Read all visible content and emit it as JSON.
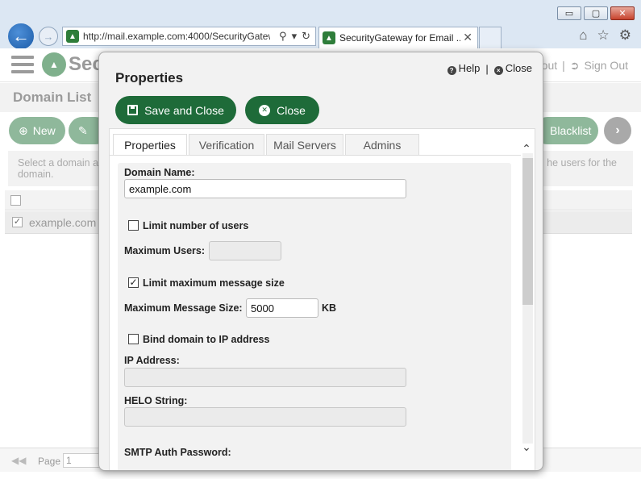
{
  "browser": {
    "url": "http://mail.example.com:4000/SecurityGatew",
    "tab_title": "SecurityGateway for Email ...",
    "tab_close": "✕",
    "window_controls": {
      "minimize": "▭",
      "maximize": "▢",
      "close": "✕"
    },
    "icons": [
      "back-arrow-icon",
      "forward-arrow-icon",
      "search-icon",
      "dropdown-icon",
      "refresh-icon",
      "home-icon",
      "favorites-star-icon",
      "settings-gear-icon"
    ]
  },
  "app": {
    "logo_text": "Sec",
    "user_menu": {
      "logout_partial": "out",
      "separator": "|",
      "sign_out": "Sign Out"
    },
    "section_title": "Domain List",
    "toolbar": {
      "new_label": "New",
      "blacklist_label": "Blacklist"
    },
    "info": {
      "left_line1": "Select a domain a",
      "left_line2": "domain.",
      "right_text": "he users for the"
    },
    "grid": {
      "rows": [
        {
          "checked": true,
          "domain": "example.com"
        }
      ]
    },
    "pager": {
      "label": "Page",
      "value": "1"
    }
  },
  "modal": {
    "title": "Properties",
    "help_label": "Help",
    "separator": "|",
    "close_link_label": "Close",
    "save_close_label": "Save and Close",
    "close_button_label": "Close",
    "tabs": [
      {
        "label": "Properties",
        "active": true
      },
      {
        "label": "Verification",
        "active": false
      },
      {
        "label": "Mail Servers",
        "active": false
      },
      {
        "label": "Admins",
        "active": false
      }
    ],
    "form": {
      "domain_name_label": "Domain Name:",
      "domain_name_value": "example.com",
      "limit_users_label": "Limit number of users",
      "limit_users_checked": false,
      "max_users_label": "Maximum Users:",
      "max_users_value": "",
      "limit_size_label": "Limit maximum message size",
      "limit_size_checked": true,
      "max_size_label": "Maximum Message Size:",
      "max_size_value": "5000",
      "max_size_unit": "KB",
      "bind_ip_label": "Bind domain to IP address",
      "bind_ip_checked": false,
      "ip_label": "IP Address:",
      "ip_value": "",
      "helo_label": "HELO String:",
      "helo_value": "",
      "smtp_auth_label": "SMTP Auth Password:"
    }
  },
  "colors": {
    "primary_green": "#1e6b39",
    "muted_green": "#8fb89b",
    "ie_blue": "#1c5ca8"
  }
}
